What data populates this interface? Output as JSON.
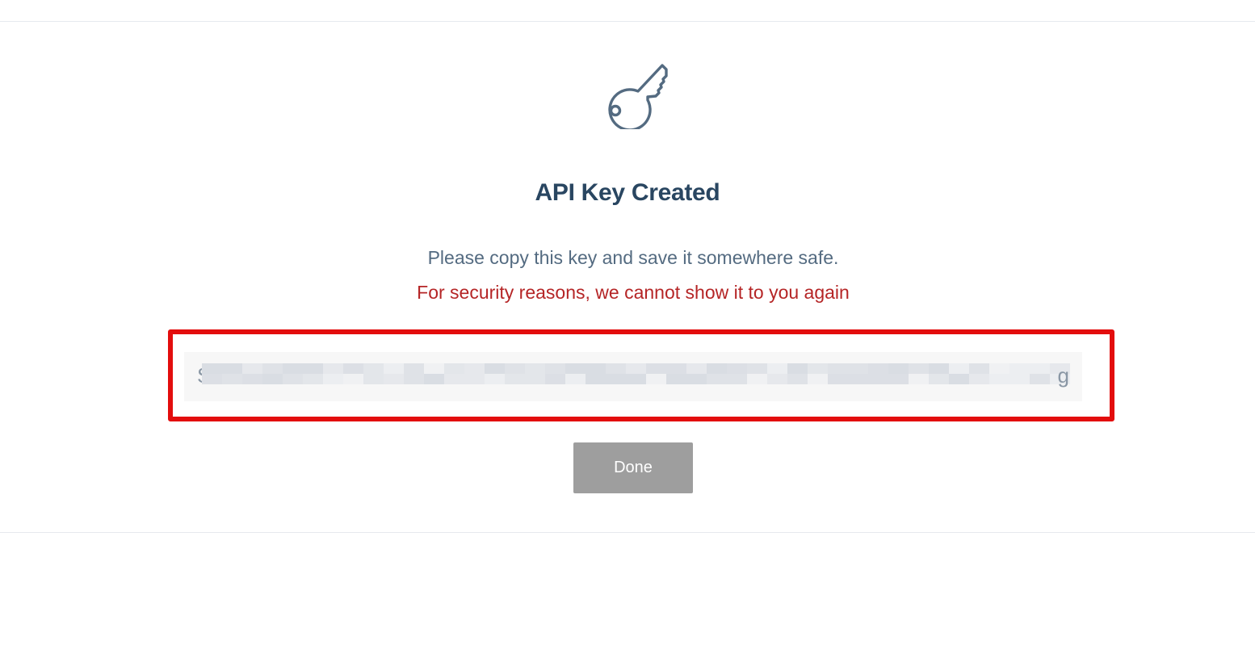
{
  "dialog": {
    "title": "API Key Created",
    "instruction": "Please copy this key and save it somewhere safe.",
    "warning": "For security reasons, we cannot show it to you again",
    "key_icon": "key-icon"
  },
  "api_key": {
    "visible_start": "S",
    "visible_end": "g",
    "redacted": true
  },
  "actions": {
    "done_label": "Done"
  },
  "colors": {
    "title": "#294661",
    "instruction": "#546b81",
    "warning": "#b52526",
    "highlight_border": "#e30d0d",
    "done_button_bg": "#9e9e9e"
  }
}
